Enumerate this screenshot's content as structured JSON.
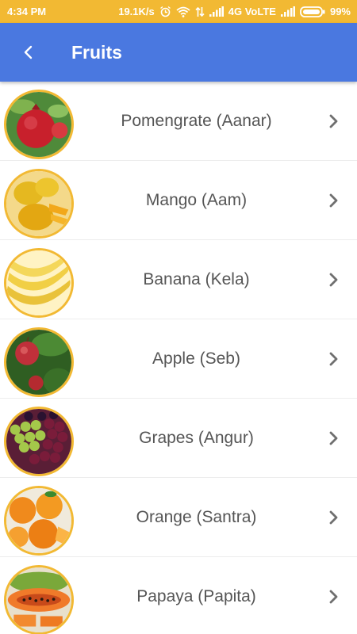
{
  "status": {
    "time": "4:34 PM",
    "speed": "19.1K/s",
    "network": "4G VoLTE",
    "battery": "99%"
  },
  "appbar": {
    "title": "Fruits"
  },
  "fruits": [
    {
      "label": "Pomengrate (Aanar)",
      "icon": "pomegranate-image"
    },
    {
      "label": "Mango (Aam)",
      "icon": "mango-image"
    },
    {
      "label": "Banana (Kela)",
      "icon": "banana-image"
    },
    {
      "label": "Apple (Seb)",
      "icon": "apple-image"
    },
    {
      "label": "Grapes (Angur)",
      "icon": "grapes-image"
    },
    {
      "label": "Orange (Santra)",
      "icon": "orange-image"
    },
    {
      "label": "Papaya (Papita)",
      "icon": "papaya-image"
    }
  ],
  "colors": {
    "status_bar": "#f2b933",
    "app_bar": "#4a78e0",
    "thumb_border": "#f2b933"
  }
}
